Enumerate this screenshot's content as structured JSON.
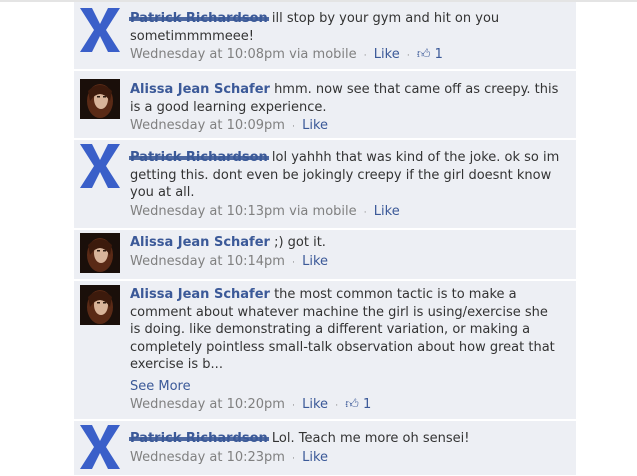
{
  "comments": [
    {
      "author": "Patrick Richardson",
      "redacted": true,
      "text": " ill stop by your gym and hit on you sometimmmmeee!",
      "timestamp": "Wednesday at 10:08pm",
      "via": "via mobile",
      "like_label": "Like",
      "like_count": "1"
    },
    {
      "author": "Alissa Jean Schafer",
      "text": " hmm. now see that came off as creepy. this is a good learning experience.",
      "timestamp": "Wednesday at 10:09pm",
      "like_label": "Like"
    },
    {
      "author": "Patrick Richardson",
      "redacted": true,
      "text": " lol yahhh that was kind of the joke. ok so im getting this. dont even be jokingly creepy if the girl doesnt know you at all.",
      "timestamp": "Wednesday at 10:13pm",
      "via": "via mobile",
      "like_label": "Like"
    },
    {
      "author": "Alissa Jean Schafer",
      "text": " ;) got it.",
      "timestamp": "Wednesday at 10:14pm",
      "like_label": "Like"
    },
    {
      "author": "Alissa Jean Schafer",
      "text": " the most common tactic is to make a comment about whatever machine the girl is using/exercise she is doing. like demonstrating a different variation, or making a completely pointless small-talk observation about how great that exercise is b...",
      "see_more": "See More",
      "timestamp": "Wednesday at 10:20pm",
      "like_label": "Like",
      "like_count": "1"
    },
    {
      "author": "Patrick Richardson",
      "redacted": true,
      "text": " Lol. Teach me more oh sensei!",
      "timestamp": "Wednesday at 10:23pm",
      "like_label": "Like"
    }
  ],
  "colors": {
    "link": "#3b5998",
    "comment_bg": "#edeff4",
    "meta": "#808080",
    "redaction_x": "#3a5fc9"
  },
  "icons": [
    "x-redaction-avatar",
    "profile-photo-avatar",
    "thumbs-up-icon"
  ]
}
